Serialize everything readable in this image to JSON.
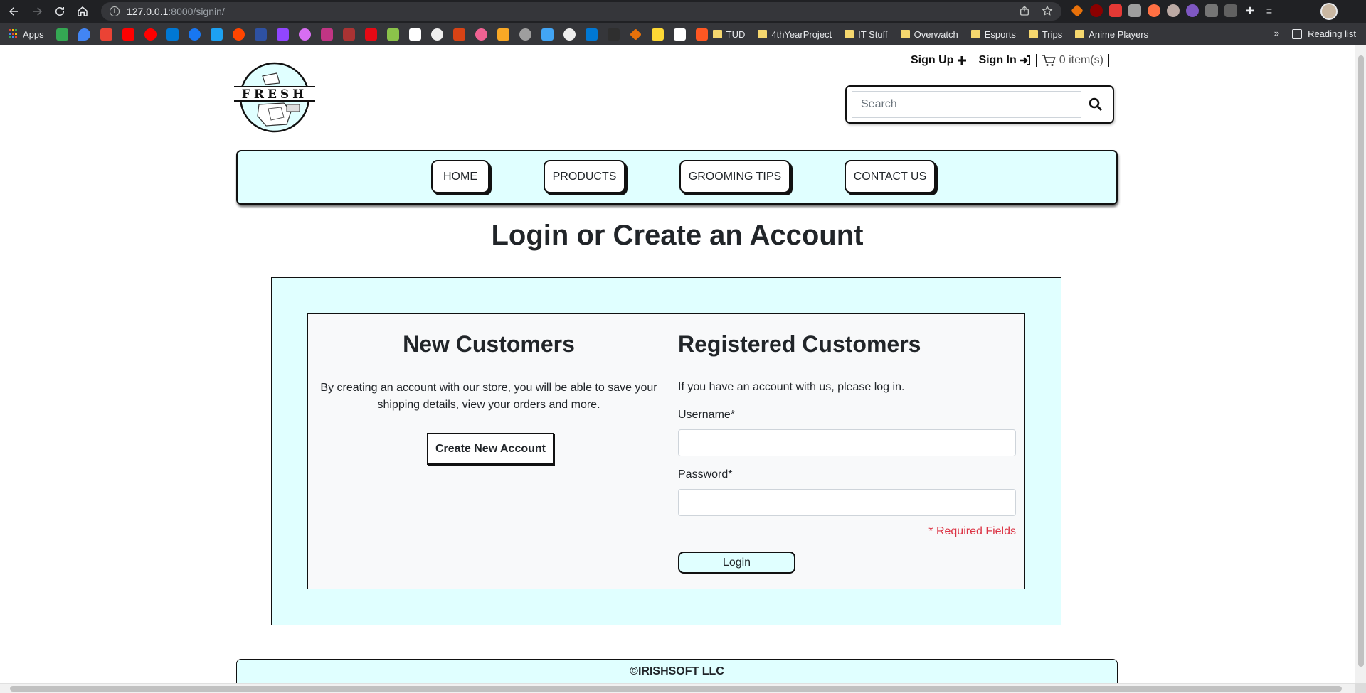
{
  "browser": {
    "url_host": "127.0.0.1",
    "url_path": ":8000/signin/",
    "bookmarks": {
      "apps_label": "Apps",
      "folders": [
        "TUD",
        "4thYearProject",
        "IT Stuff",
        "Overwatch",
        "Esports",
        "Trips",
        "Anime Players"
      ],
      "more": "»",
      "reading_list": "Reading list"
    }
  },
  "header": {
    "logo_text": "FRESH",
    "sign_up": "Sign Up",
    "sign_in": "Sign In",
    "cart": "0 item(s)",
    "search_placeholder": "Search"
  },
  "nav": {
    "items": [
      {
        "label": "HOME"
      },
      {
        "label": "PRODUCTS"
      },
      {
        "label": "GROOMING TIPS"
      },
      {
        "label": "CONTACT US"
      }
    ]
  },
  "main": {
    "title": "Login or Create an Account",
    "new_customers": {
      "heading": "New Customers",
      "text": "By creating an account with our store, you will be able to save your shipping details, view your orders and more.",
      "button": "Create New Account"
    },
    "registered": {
      "heading": "Registered Customers",
      "intro": "If you have an account with us, please log in.",
      "username_label": "Username*",
      "password_label": "Password*",
      "required_note": "* Required Fields",
      "login_button": "Login"
    }
  },
  "footer": {
    "copyright": "©IRISHSOFT LLC"
  },
  "colors": {
    "panel_bg": "#e0ffff",
    "required": "#dc3545",
    "border": "#111111"
  }
}
